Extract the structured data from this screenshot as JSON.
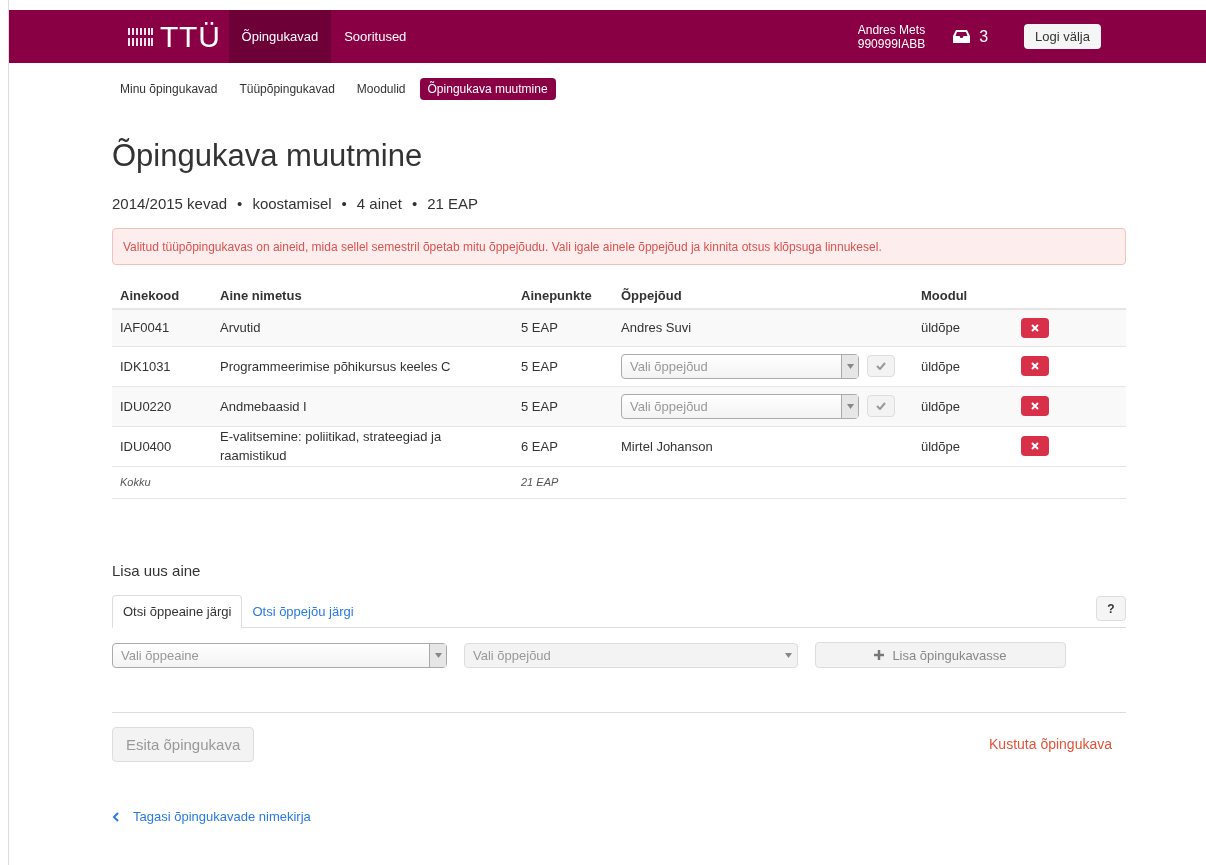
{
  "header": {
    "logo": "TTÜ",
    "nav": [
      {
        "label": "Õpingukavad",
        "selected": true
      },
      {
        "label": "Sooritused",
        "selected": false
      }
    ],
    "user": {
      "name": "Andres Mets",
      "code": "990999IABB"
    },
    "inbox_count": "3",
    "logout": "Logi välja"
  },
  "subnav": [
    {
      "label": "Minu õpingukavad",
      "selected": false
    },
    {
      "label": "Tüüpõpingukavad",
      "selected": false
    },
    {
      "label": "Moodulid",
      "selected": false
    },
    {
      "label": "Õpingukava muutmine",
      "selected": true
    }
  ],
  "title": "Õpingukava muutmine",
  "meta": [
    "2014/2015 kevad",
    "koostamisel",
    "4 ainet",
    "21 EAP"
  ],
  "meta_separator": "•",
  "alert": "Valitud tüüpõpingukavas on aineid, mida sellel semestril õpetab mitu õppejõudu. Vali igale ainele õppejõud ja kinnita otsus klõpsuga linnukesel.",
  "table": {
    "columns": [
      "Ainekood",
      "Aine nimetus",
      "Ainepunkte",
      "Õppejõud",
      "Moodul"
    ],
    "rows": [
      {
        "code": "IAF0041",
        "name": "Arvutid",
        "credits": "5 EAP",
        "teacher": {
          "kind": "text",
          "value": "Andres Suvi"
        },
        "module": "üldõpe"
      },
      {
        "code": "IDK1031",
        "name": "Programmeerimise põhikursus keeles C",
        "credits": "5 EAP",
        "teacher": {
          "kind": "select",
          "placeholder": "Vali õppejõud"
        },
        "module": "üldõpe"
      },
      {
        "code": "IDU0220",
        "name": "Andmebaasid I",
        "credits": "5 EAP",
        "teacher": {
          "kind": "select",
          "placeholder": "Vali õppejõud"
        },
        "module": "üldõpe"
      },
      {
        "code": "IDU0400",
        "name": "E-valitsemine: poliitikad, strateegiad ja raamistikud",
        "credits": "6 EAP",
        "teacher": {
          "kind": "text",
          "value": "Mirtel Johanson"
        },
        "module": "üldõpe"
      }
    ],
    "total": {
      "label": "Kokku",
      "credits": "21 EAP"
    }
  },
  "add_section": {
    "title": "Lisa uus aine",
    "tabs": [
      {
        "label": "Otsi õppeaine järgi",
        "selected": true
      },
      {
        "label": "Otsi õppejõu järgi",
        "selected": false
      }
    ],
    "help": "?",
    "subject_select": {
      "placeholder": "Vali õppeaine",
      "disabled": false
    },
    "teacher_select": {
      "placeholder": "Vali õppejõud",
      "disabled": true
    },
    "add_button": {
      "label": "Lisa õpingukavasse",
      "disabled": true
    }
  },
  "submit": {
    "label": "Esita õpingukava",
    "disabled": true
  },
  "delete_link": "Kustuta õpingukava",
  "back_link": "Tagasi õpingukavade nimekirja"
}
